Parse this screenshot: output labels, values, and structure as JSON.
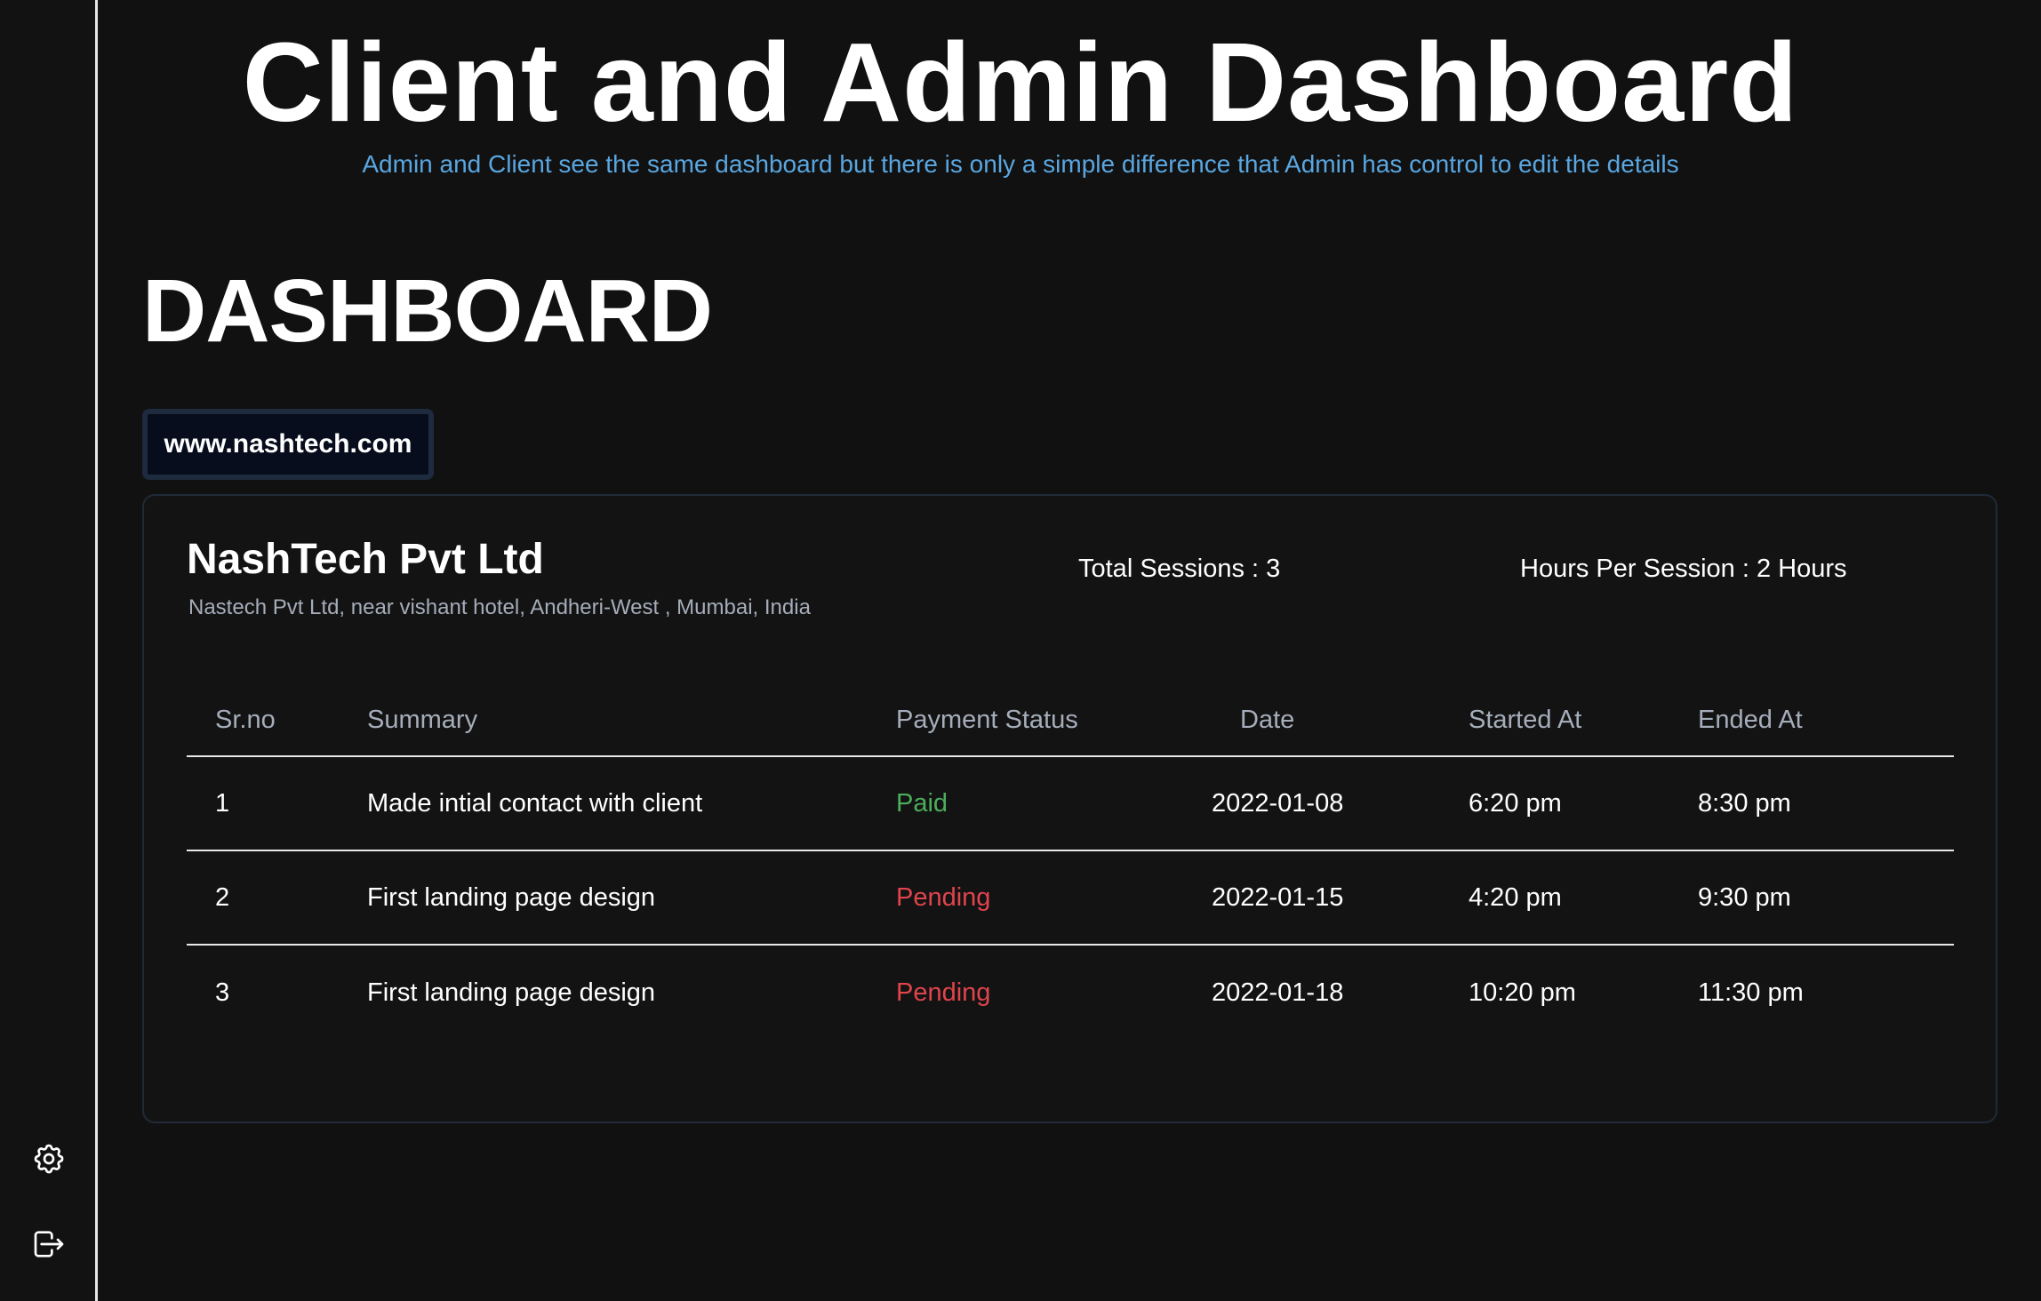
{
  "hero": {
    "title": "Client and Admin Dashboard",
    "subtitle": "Admin and Client see the same dashboard but there is only a simple difference that Admin has control to edit the details"
  },
  "page": {
    "title": "DASHBOARD"
  },
  "url_chip": {
    "label": "www.nashtech.com"
  },
  "company": {
    "name": "NashTech Pvt Ltd",
    "address": "Nastech Pvt Ltd, near vishant hotel, Andheri-West , Mumbai, India",
    "total_sessions": "Total Sessions : 3",
    "hours_per_session": "Hours Per Session : 2 Hours"
  },
  "table": {
    "headers": {
      "sr": "Sr.no",
      "summary": "Summary",
      "payment": "Payment Status",
      "date": "Date",
      "started": "Started At",
      "ended": "Ended At"
    },
    "rows": [
      {
        "sr": "1",
        "summary": "Made intial contact with client",
        "payment": "Paid",
        "date": "2022-01-08",
        "started": "6:20 pm",
        "ended": "8:30 pm"
      },
      {
        "sr": "2",
        "summary": "First landing page design",
        "payment": "Pending",
        "date": "2022-01-15",
        "started": "4:20 pm",
        "ended": "9:30 pm"
      },
      {
        "sr": "3",
        "summary": "First landing page design",
        "payment": "Pending",
        "date": "2022-01-18",
        "started": "10:20 pm",
        "ended": "11:30 pm"
      }
    ]
  },
  "sidebar": {
    "icons": [
      "gear-icon",
      "logout-icon"
    ]
  },
  "colors": {
    "background": "#111111",
    "subtitle": "#5aa6e0",
    "paid": "#4cae5a",
    "pending": "#e0444c",
    "muted": "#a6adba"
  }
}
